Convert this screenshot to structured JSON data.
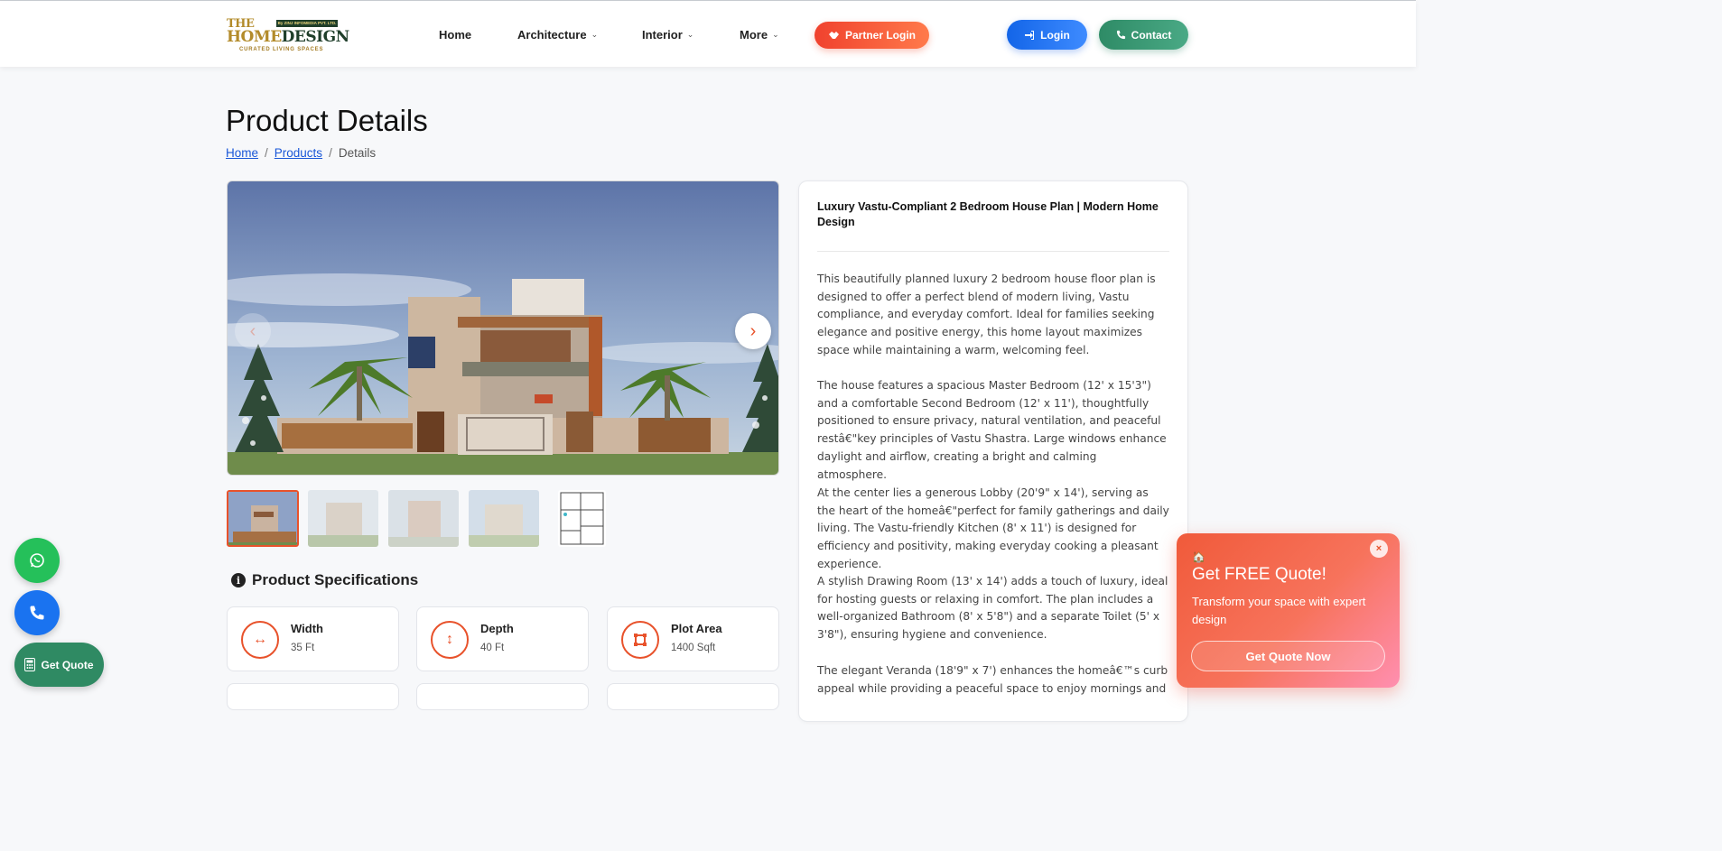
{
  "logo": {
    "line1": "THE",
    "tagline_badge": "By ZINJ INFOMEDIA PVT. LTD.",
    "line2_a": "HOME",
    "line2_b": "DESIGN",
    "slogan": "CURATED LIVING SPACES"
  },
  "nav": {
    "items": [
      {
        "label": "Home"
      },
      {
        "label": "Architecture"
      },
      {
        "label": "Interior"
      },
      {
        "label": "More"
      }
    ],
    "partner_login": "Partner Login",
    "login": "Login",
    "contact": "Contact"
  },
  "page": {
    "title": "Product Details",
    "breadcrumb": [
      {
        "label": "Home"
      },
      {
        "label": "Products"
      },
      {
        "label": "Details"
      }
    ],
    "breadcrumb_separator": "/"
  },
  "gallery": {
    "thumbnail_count": 5,
    "active_index": 0
  },
  "specs": {
    "heading": "Product Specifications",
    "items": [
      {
        "label": "Width",
        "value": "35 Ft"
      },
      {
        "label": "Depth",
        "value": "40 Ft"
      },
      {
        "label": "Plot Area",
        "value": "1400 Sqft"
      }
    ]
  },
  "product": {
    "title": "Luxury Vastu-Compliant 2 Bedroom House Plan | Modern Home Design",
    "paragraphs": [
      "This beautifully planned luxury 2 bedroom house floor plan is designed to offer a perfect blend of modern living, Vastu compliance, and everyday comfort. Ideal for families seeking elegance and positive energy, this home layout maximizes space while maintaining a warm, welcoming feel.",
      "The house features a spacious Master Bedroom (12' x 15'3\") and a comfortable Second Bedroom (12' x 11'), thoughtfully positioned to ensure privacy, natural ventilation, and peaceful restâ€\"key principles of Vastu Shastra. Large windows enhance daylight and airflow, creating a bright and calming atmosphere.",
      "At the center lies a generous Lobby (20'9\" x 14'), serving as the heart of the homeâ€\"perfect for family gatherings and daily living. The Vastu-friendly Kitchen (8' x 11') is designed for efficiency and positivity, making everyday cooking a pleasant experience.",
      "A stylish Drawing Room (13' x 14') adds a touch of luxury, ideal for hosting guests or relaxing in comfort. The plan includes a well-organized Bathroom (8' x 5'8\") and a separate Toilet (5' x 3'8\"), ensuring hygiene and convenience.",
      "The elegant Veranda (18'9\" x 7') enhances the homeâ€™s curb appeal while providing a peaceful space to enjoy mornings and"
    ]
  },
  "floating": {
    "get_quote": "Get Quote"
  },
  "popup": {
    "title": "Get FREE Quote!",
    "subtitle": "Transform your space with expert design",
    "cta": "Get Quote Now",
    "close": "×"
  },
  "colors": {
    "accent": "#e8522b",
    "login_blue": "#1a6ef0",
    "contact_green": "#2f8a63",
    "whatsapp_green": "#25c05a"
  }
}
